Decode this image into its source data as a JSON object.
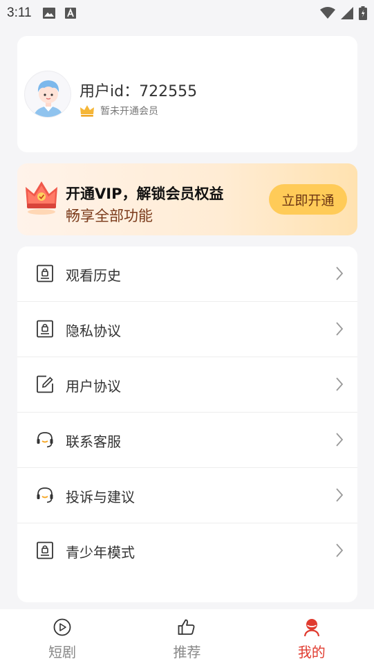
{
  "status_bar": {
    "time": "3:11",
    "icons": [
      "image-icon",
      "translate-icon",
      "wifi-icon",
      "signal-icon",
      "battery-icon"
    ]
  },
  "profile": {
    "user_id": "用户id：722555",
    "member_status": "暂未开通会员",
    "icons": [
      "avatar",
      "crown-icon"
    ]
  },
  "vip_banner": {
    "title": "开通VIP，解锁会员权益",
    "subtitle": "畅享全部功能",
    "button_label": "立即开通",
    "colors": {
      "button": "#ffcb58",
      "subtitle": "#7a3a1a"
    }
  },
  "menu": {
    "items": [
      {
        "label": "观看历史",
        "icon": "lock-doc-icon"
      },
      {
        "label": "隐私协议",
        "icon": "lock-doc-icon"
      },
      {
        "label": "用户协议",
        "icon": "edit-doc-icon"
      },
      {
        "label": "联系客服",
        "icon": "headset-icon"
      },
      {
        "label": "投诉与建议",
        "icon": "headset-icon"
      },
      {
        "label": "青少年模式",
        "icon": "lock-doc-icon"
      }
    ]
  },
  "bottom_nav": {
    "items": [
      {
        "label": "短剧",
        "icon": "play-circle-icon",
        "active": false
      },
      {
        "label": "推荐",
        "icon": "thumbs-up-icon",
        "active": false
      },
      {
        "label": "我的",
        "icon": "user-icon",
        "active": true
      }
    ],
    "active_color": "#e03b2f"
  }
}
